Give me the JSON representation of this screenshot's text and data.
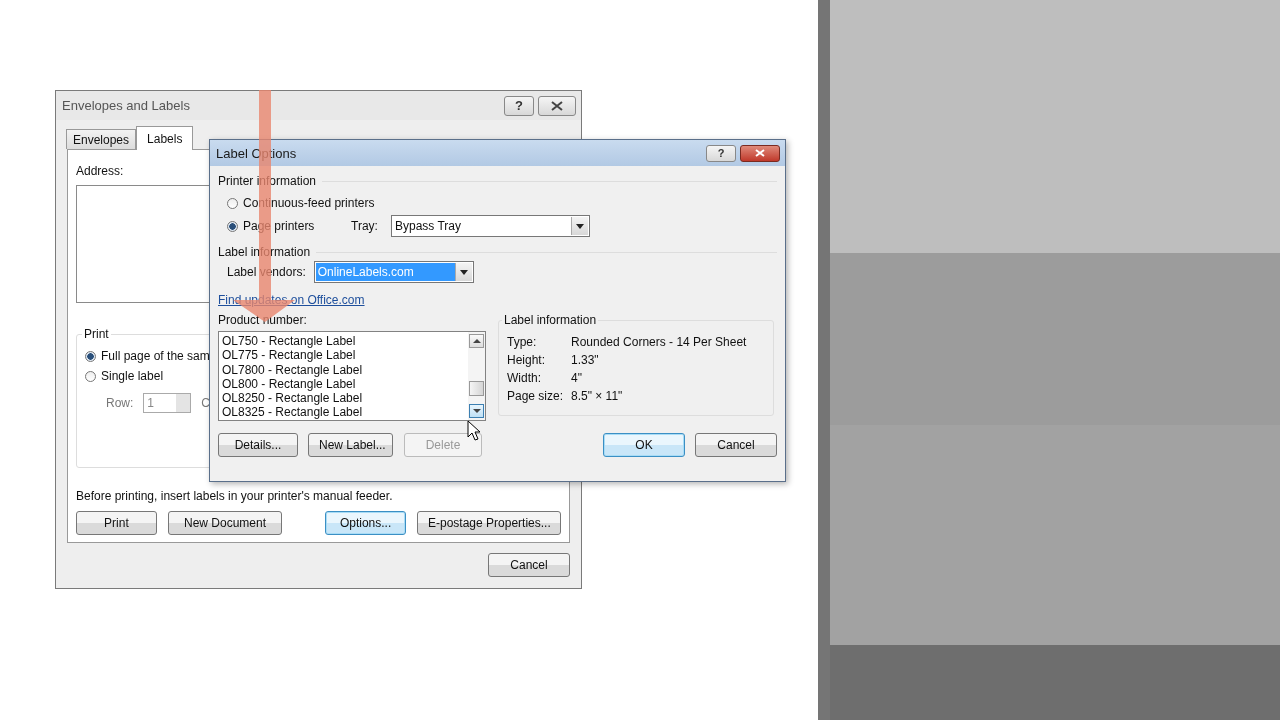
{
  "back_dialog": {
    "title": "Envelopes and Labels",
    "help": "?",
    "tabs": [
      {
        "label": "Envelopes",
        "selected": false
      },
      {
        "label": "Labels",
        "selected": true
      }
    ],
    "address_label": "Address:",
    "print_group": {
      "title": "Print",
      "options": [
        {
          "label": "Full page of the sam",
          "selected": true
        },
        {
          "label": "Single label",
          "selected": false
        }
      ],
      "row_label": "Row:",
      "row_value": "1",
      "column_label": "C"
    },
    "note": "Before printing, insert labels in your printer's manual feeder.",
    "buttons": [
      {
        "label": "Print",
        "focused": false
      },
      {
        "label": "New Document",
        "focused": false
      },
      {
        "label": "Options...",
        "focused": true
      },
      {
        "label": "E-postage Properties...",
        "focused": false
      }
    ],
    "cancel": "Cancel"
  },
  "front_dialog": {
    "title": "Label Options",
    "help": "?",
    "printer_group": {
      "title": "Printer information",
      "options": [
        {
          "label": "Continuous-feed printers",
          "selected": false
        },
        {
          "label": "Page printers",
          "selected": true
        }
      ],
      "tray_label": "Tray:",
      "tray_value": "Bypass Tray"
    },
    "label_group": {
      "title": "Label information",
      "vendors_label": "Label vendors:",
      "vendors_value": "OnlineLabels.com"
    },
    "link": "Find updates on Office.com",
    "product_label": "Product number:",
    "products": [
      {
        "label": "OL750 - Rectangle Label",
        "selected": false
      },
      {
        "label": "OL775 - Rectangle Label",
        "selected": false
      },
      {
        "label": "OL7800 - Rectangle Label",
        "selected": false
      },
      {
        "label": "OL800 - Rectangle Label",
        "selected": false
      },
      {
        "label": "OL8250 - Rectangle Label",
        "selected": false
      },
      {
        "label": "OL8325 - Rectangle Label",
        "selected": false
      }
    ],
    "info": {
      "title": "Label information",
      "rows": [
        {
          "name": "Type:",
          "value": "Rounded Corners - 14 Per Sheet"
        },
        {
          "name": "Height:",
          "value": "1.33\""
        },
        {
          "name": "Width:",
          "value": "4\""
        },
        {
          "name": "Page size:",
          "value": "8.5\" × 11\""
        }
      ]
    },
    "list_buttons": [
      {
        "label": "Details...",
        "disabled": false
      },
      {
        "label": "New Label...",
        "disabled": false
      },
      {
        "label": "Delete",
        "disabled": true
      }
    ],
    "buttons": [
      {
        "label": "OK",
        "focused": true
      },
      {
        "label": "Cancel",
        "focused": false
      }
    ]
  }
}
